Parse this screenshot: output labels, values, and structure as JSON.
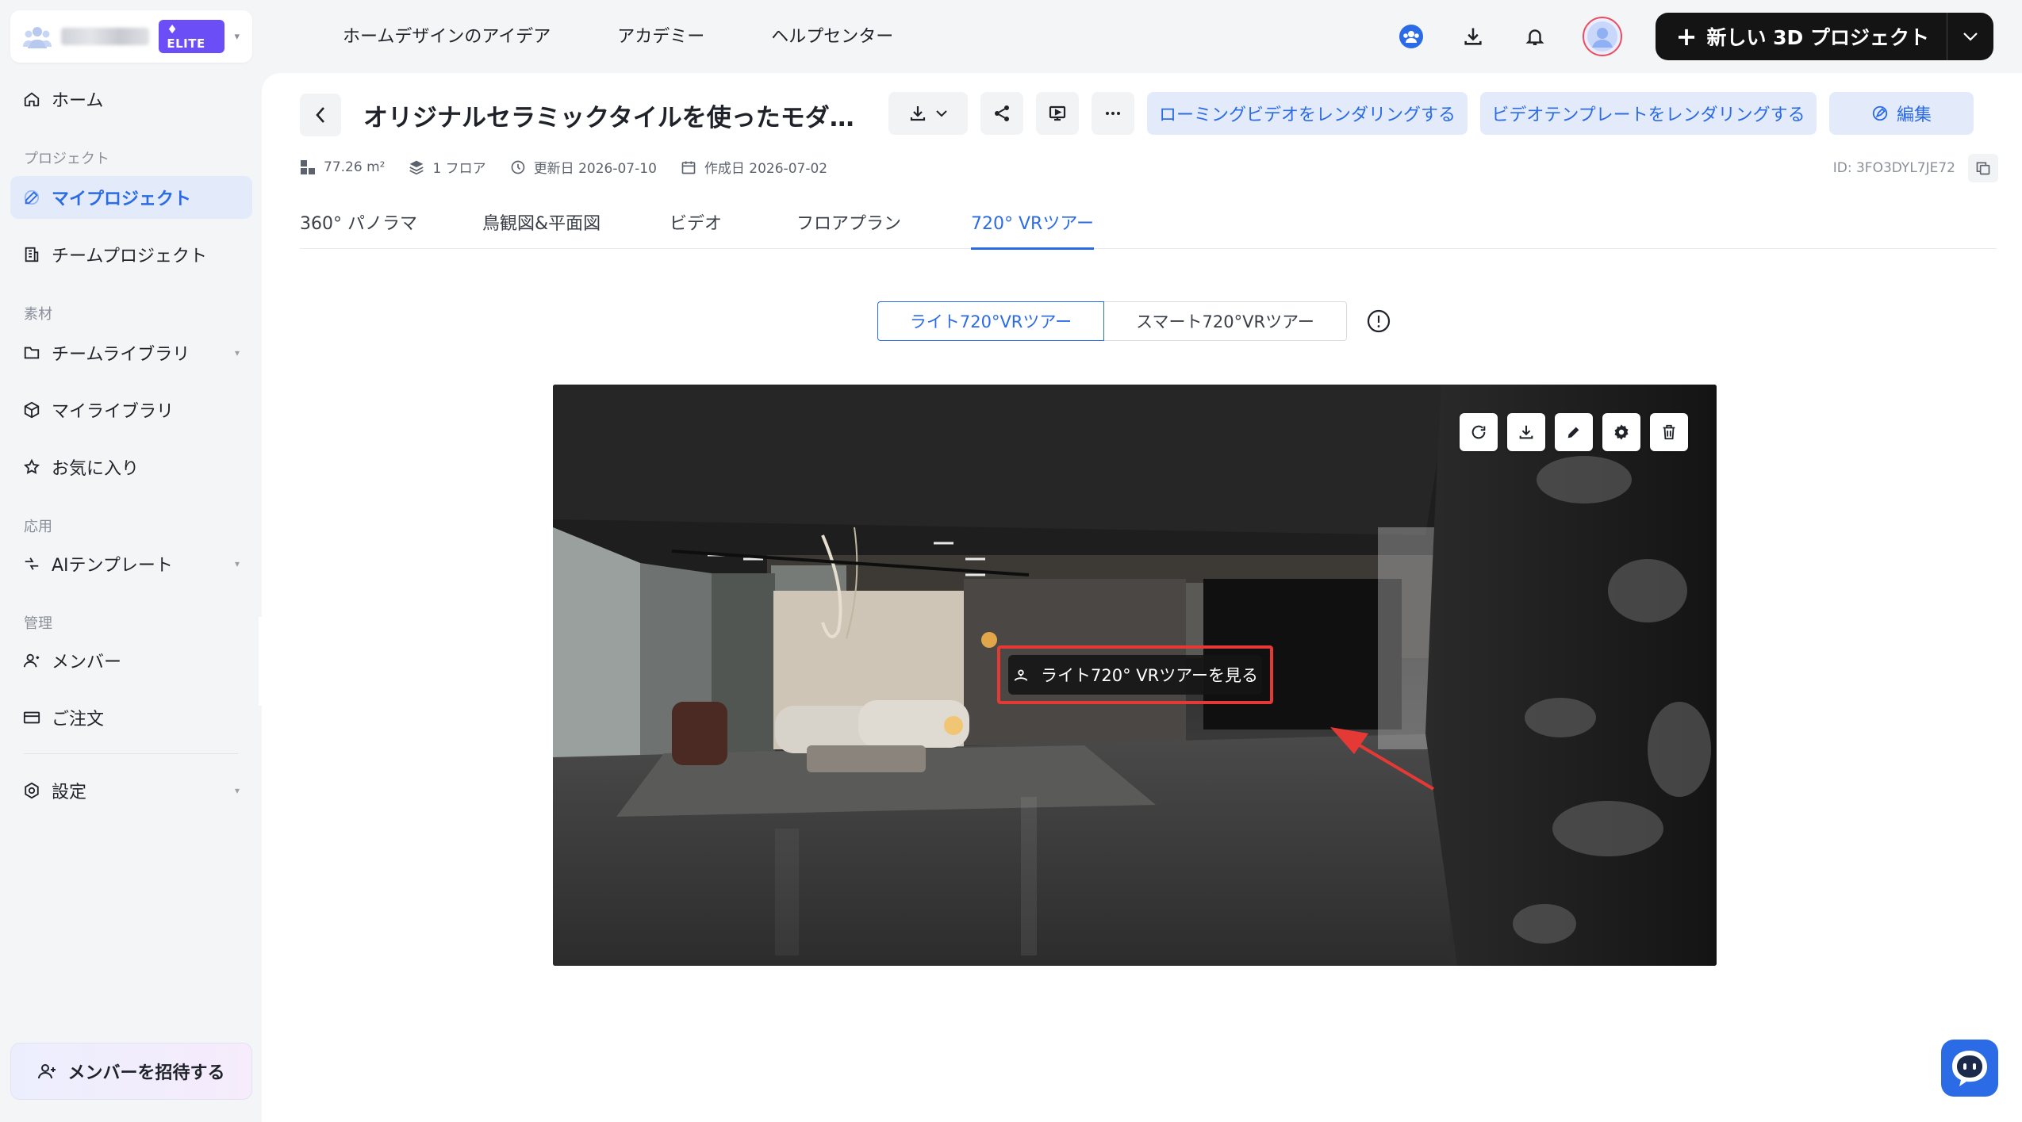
{
  "sidebar": {
    "team": {
      "badge": "ELITE"
    },
    "items": [
      {
        "label": "ホーム",
        "icon": "home-icon"
      },
      {
        "label": "マイプロジェクト",
        "icon": "edit-icon"
      },
      {
        "label": "チームプロジェクト",
        "icon": "building-icon"
      },
      {
        "label": "チームライブラリ",
        "icon": "folder-icon"
      },
      {
        "label": "マイライブラリ",
        "icon": "cube-icon"
      },
      {
        "label": "お気に入り",
        "icon": "star-icon"
      },
      {
        "label": "AIテンプレート",
        "icon": "bolt-icon"
      },
      {
        "label": "メンバー",
        "icon": "members-icon"
      },
      {
        "label": "ご注文",
        "icon": "card-icon"
      },
      {
        "label": "設定",
        "icon": "settings-icon"
      }
    ],
    "sections": {
      "project": "プロジェクト",
      "material": "素材",
      "application": "応用",
      "management": "管理"
    },
    "invite_label": "メンバーを招待する"
  },
  "topnav": {
    "items": [
      "ホームデザインのアイデア",
      "アカデミー",
      "ヘルプセンター"
    ],
    "new_project_label": "新しい 3D プロジェクト"
  },
  "project": {
    "title": "オリジナルセラミックタイルを使ったモダ…",
    "actions": {
      "roaming_video": "ローミングビデオをレンダリングする",
      "video_template": "ビデオテンプレートをレンダリングする",
      "edit": "編集"
    },
    "meta": {
      "area": "77.26 m²",
      "floors": "1 フロア",
      "updated": "更新日 2026-07-10",
      "created": "作成日 2026-07-02",
      "id": "ID: 3FO3DYL7JE72"
    },
    "tabs": [
      "360° パノラマ",
      "鳥観図&平面図",
      "ビデオ",
      "フロアプラン",
      "720° VRツアー"
    ],
    "active_tab": "720° VRツアー"
  },
  "vr": {
    "modes": [
      "ライト720°VRツアー",
      "スマート720°VRツアー"
    ],
    "active_mode": "ライト720°VRツアー",
    "view_button": "ライト720° VRツアーを見る"
  },
  "colors": {
    "accent": "#2b6be6",
    "elite": "#6b4ef6",
    "highlight": "#e53935"
  }
}
